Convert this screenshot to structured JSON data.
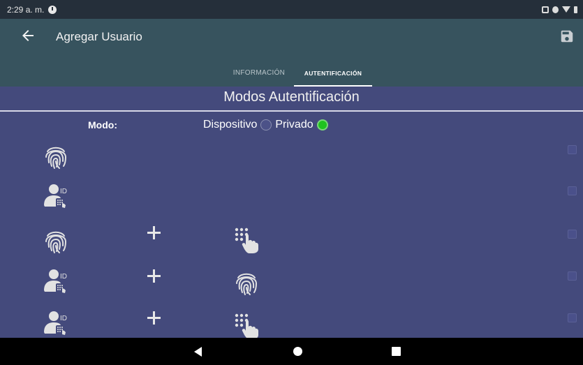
{
  "status_bar": {
    "time": "2:29 a. m.",
    "icons": [
      "clock-icon",
      "screenshot-icon",
      "data-saver-icon",
      "wifi-icon",
      "battery-icon"
    ]
  },
  "app_bar": {
    "title": "Agregar Usuario",
    "back_icon": "arrow-left-icon",
    "save_icon": "save-icon"
  },
  "tabs": [
    {
      "label": "INFORMACIÓN",
      "selected": false
    },
    {
      "label": "AUTENTIFICACIÓN",
      "selected": true
    }
  ],
  "content": {
    "title": "Modos Autentificación",
    "mode_label": "Modo:",
    "mode_options": [
      {
        "label": "Dispositivo",
        "checked": false
      },
      {
        "label": "Privado",
        "checked": true
      }
    ],
    "auth_rows": [
      {
        "methods": [
          "fingerprint-icon"
        ],
        "checked": false
      },
      {
        "methods": [
          "user-id-icon"
        ],
        "checked": false
      },
      {
        "methods": [
          "fingerprint-icon",
          "keypad-icon"
        ],
        "checked": false
      },
      {
        "methods": [
          "user-id-icon",
          "fingerprint-icon"
        ],
        "checked": false
      },
      {
        "methods": [
          "user-id-icon",
          "keypad-icon"
        ],
        "checked": false
      }
    ]
  },
  "colors": {
    "status_bar": "#252f3a",
    "app_bar": "#37535e",
    "content_bg": "#444a7c",
    "radio_checked": "#1fc21f",
    "icon": "#e2e2e2"
  },
  "nav_bar": {
    "icons": [
      "nav-back-icon",
      "nav-home-icon",
      "nav-recents-icon"
    ]
  }
}
